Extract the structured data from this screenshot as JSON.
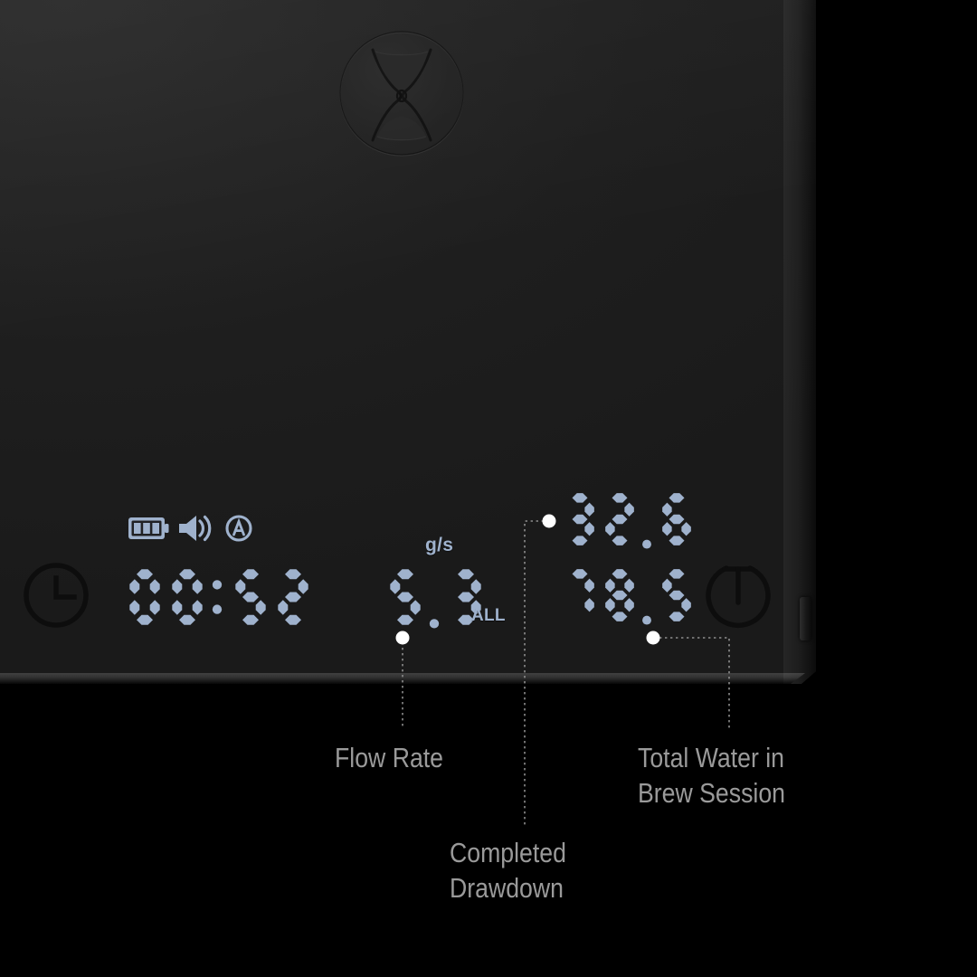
{
  "device": {
    "name": "coffee-brew-scale",
    "brand_logo": "hourglass-logo",
    "surface_color": "#1f1f1f",
    "lcd_color": "#9fb2cd"
  },
  "status_icons": [
    {
      "name": "battery-icon",
      "label": "battery",
      "state": "3 bars"
    },
    {
      "name": "speaker-icon",
      "label": "sound on"
    },
    {
      "name": "auto-mode-icon",
      "label": "A"
    }
  ],
  "display": {
    "timer": {
      "icon": "clock-icon",
      "value": "00:52"
    },
    "flow_rate": {
      "unit": "g/s",
      "value": "5.3",
      "mode": "ALL"
    },
    "weights": {
      "drawdown_value": "32.6",
      "total_water_value": "78.5"
    },
    "tare": {
      "icon": "tare-icon",
      "label": "T"
    }
  },
  "callouts": [
    {
      "name": "flow-rate",
      "text": "Flow Rate"
    },
    {
      "name": "completed-drawdown",
      "text": "Completed\nDrawdown"
    },
    {
      "name": "total-water",
      "text": "Total Water in\nBrew Session"
    }
  ],
  "colors": {
    "lcd_segment_on": "#9fb2cd",
    "lcd_segment_off": "#2a2c31",
    "callout_text": "#9a9a9a",
    "leader_line": "#8d8d8d",
    "dot": "#ffffff",
    "background": "#000000"
  }
}
